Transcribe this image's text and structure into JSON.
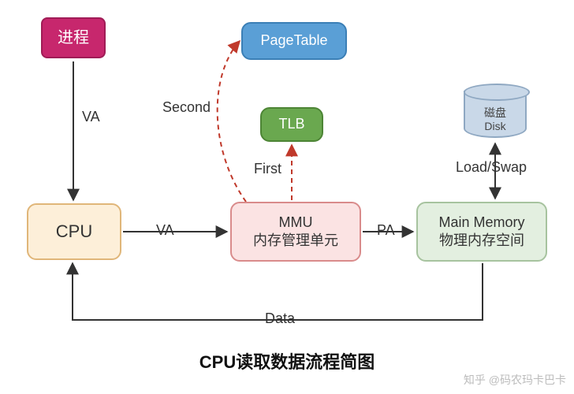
{
  "nodes": {
    "process": "进程",
    "cpu": "CPU",
    "pagetable": "PageTable",
    "tlb": "TLB",
    "mmu_line1": "MMU",
    "mmu_line2": "内存管理单元",
    "mem_line1": "Main Memory",
    "mem_line2": "物理内存空间",
    "disk_line1": "磁盘",
    "disk_line2": "Disk"
  },
  "edges": {
    "va_proc_cpu": "VA",
    "va_cpu_mmu": "VA",
    "first": "First",
    "second": "Second",
    "pa": "PA",
    "loadswap": "Load/Swap",
    "data": "Data"
  },
  "title": "CPU读取数据流程简图",
  "watermark": "知乎 @码农玛卡巴卡",
  "chart_data": {
    "type": "diagram",
    "title": "CPU读取数据流程简图",
    "nodes": [
      {
        "id": "process",
        "label": "进程"
      },
      {
        "id": "cpu",
        "label": "CPU"
      },
      {
        "id": "mmu",
        "label": "MMU 内存管理单元"
      },
      {
        "id": "tlb",
        "label": "TLB"
      },
      {
        "id": "pagetable",
        "label": "PageTable"
      },
      {
        "id": "main_memory",
        "label": "Main Memory 物理内存空间"
      },
      {
        "id": "disk",
        "label": "磁盘 Disk"
      }
    ],
    "edges": [
      {
        "from": "process",
        "to": "cpu",
        "label": "VA"
      },
      {
        "from": "cpu",
        "to": "mmu",
        "label": "VA"
      },
      {
        "from": "mmu",
        "to": "tlb",
        "label": "First",
        "style": "dashed"
      },
      {
        "from": "mmu",
        "to": "pagetable",
        "label": "Second",
        "style": "dashed"
      },
      {
        "from": "mmu",
        "to": "main_memory",
        "label": "PA"
      },
      {
        "from": "disk",
        "to": "main_memory",
        "label": "Load/Swap",
        "bidirectional": true
      },
      {
        "from": "main_memory",
        "to": "cpu",
        "label": "Data"
      }
    ]
  }
}
